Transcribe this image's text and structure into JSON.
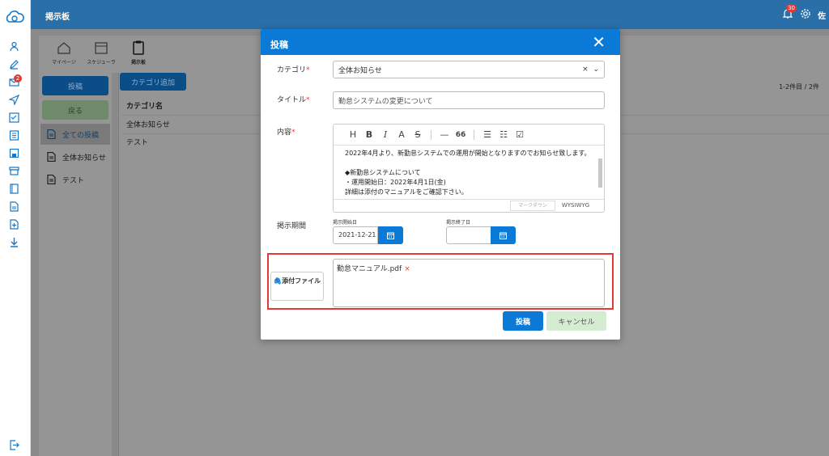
{
  "app": {
    "title": "掲示板",
    "user_initial": "佐"
  },
  "notifications": {
    "bell_count": "30",
    "mail_count": "2"
  },
  "toolbar": {
    "items": [
      {
        "label": "マイページ"
      },
      {
        "label": "スケジューラ"
      },
      {
        "label": "掲示板"
      }
    ]
  },
  "left": {
    "post_label": "投稿",
    "back_label": "戻る",
    "nav": [
      {
        "label": "全ての投稿"
      },
      {
        "label": "全体お知らせ"
      },
      {
        "label": "テスト"
      }
    ]
  },
  "content": {
    "add_category_label": "カテゴリ追加",
    "column_header": "カテゴリ名",
    "rows": [
      "全体お知らせ",
      "テスト"
    ],
    "pagination": "1-2件目 / 2件"
  },
  "modal": {
    "title": "投稿",
    "category_label": "カテゴリ",
    "category_value": "全体お知らせ",
    "title_label": "タイトル",
    "title_value": "勤怠システムの変更について",
    "content_label": "内容",
    "editor_toolbar": [
      "H",
      "B",
      "I",
      "A",
      "S",
      "—",
      "66"
    ],
    "editor_lines": [
      "2022年4月より、新勤怠システムでの運用が開始となりますのでお知らせ致します。",
      "",
      "◆新勤怠システムについて",
      "・運用開始日：2022年4月1日(金)",
      "詳細は添付のマニュアルをご確認下さい。"
    ],
    "tab_markdown": "マークダウン",
    "tab_wysiwyg": "WYSIWYG",
    "period_label": "掲示期間",
    "start_label": "掲示開始日",
    "start_value": "2021-12-21",
    "end_label": "掲示終了日",
    "end_value": "",
    "attach_button": "添付ファイル",
    "attached_file": "勤怠マニュアル.pdf",
    "post_button": "投稿",
    "cancel_button": "キャンセル"
  },
  "colors": {
    "accent": "#0b7ad6",
    "topbar": "#2a6fa8",
    "highlight": "#e53935",
    "cancel_bg": "#d5ecd3"
  }
}
